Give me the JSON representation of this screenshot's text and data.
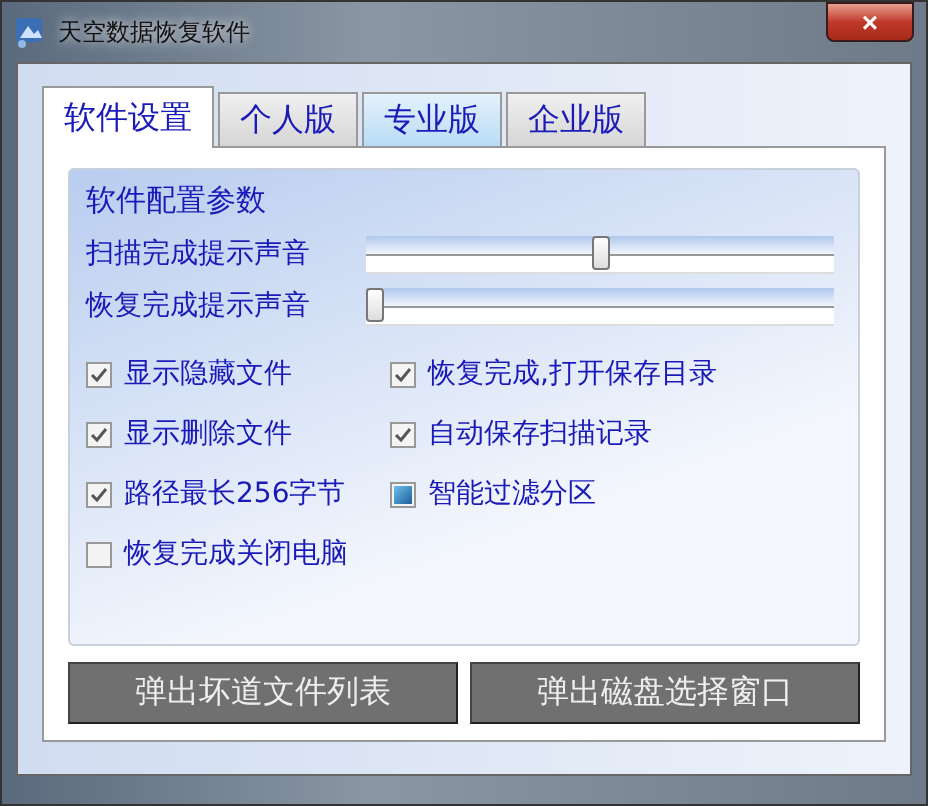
{
  "window": {
    "title": "天空数据恢复软件",
    "close": "×"
  },
  "tabs": [
    {
      "label": "软件设置",
      "selected": true,
      "highlighted": false
    },
    {
      "label": "个人版",
      "selected": false,
      "highlighted": false
    },
    {
      "label": "专业版",
      "selected": false,
      "highlighted": true
    },
    {
      "label": "企业版",
      "selected": false,
      "highlighted": false
    }
  ],
  "group": {
    "title": "软件配置参数",
    "sliders": [
      {
        "label": "扫描完成提示声音",
        "level": 0.5
      },
      {
        "label": "恢复完成提示声音",
        "level": 0
      }
    ],
    "options": [
      {
        "label": "显示隐藏文件",
        "checked": true,
        "indeterminate": false
      },
      {
        "label": "恢复完成,打开保存目录",
        "checked": true,
        "indeterminate": false
      },
      {
        "label": "显示删除文件",
        "checked": true,
        "indeterminate": false
      },
      {
        "label": "自动保存扫描记录",
        "checked": true,
        "indeterminate": false
      },
      {
        "label": "路径最长256字节",
        "checked": true,
        "indeterminate": false
      },
      {
        "label": "智能过滤分区",
        "checked": false,
        "indeterminate": true
      },
      {
        "label": "恢复完成关闭电脑",
        "checked": false,
        "indeterminate": false
      }
    ]
  },
  "buttons": [
    "弹出坏道文件列表",
    "弹出磁盘选择窗口"
  ]
}
